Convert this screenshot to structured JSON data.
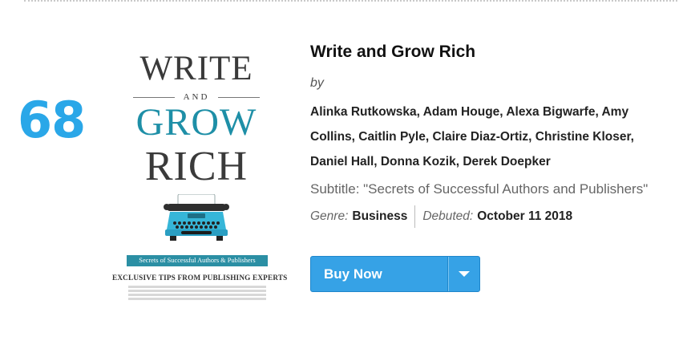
{
  "rank": "68",
  "book": {
    "title": "Write and Grow Rich",
    "by_label": "by",
    "authors": "Alinka Rutkowska, Adam Houge, Alexa Bigwarfe, Amy Collins, Caitlin Pyle, Claire Diaz-Ortiz, Christine Kloser, Daniel Hall, Donna Kozik, Derek Doepker",
    "subtitle_line": "Subtitle: \"Secrets of Successful Authors and Publishers\"",
    "genre_label": "Genre:",
    "genre": "Business",
    "debuted_label": "Debuted:",
    "debuted": "October 11 2018"
  },
  "cover": {
    "line1": "WRITE",
    "line2": "AND",
    "line3": "GROW",
    "line4": "RICH",
    "banner": "Secrets of Successful Authors & Publishers",
    "tips": "EXCLUSIVE TIPS FROM PUBLISHING EXPERTS",
    "colors": {
      "teal": "#1e8fa7",
      "dark": "#3a3a3a"
    }
  },
  "buy_button": {
    "label": "Buy Now",
    "caret_icon": "chevron-down-icon",
    "color": "#36a2e6"
  },
  "colors": {
    "rank": "#2aa7e8"
  }
}
